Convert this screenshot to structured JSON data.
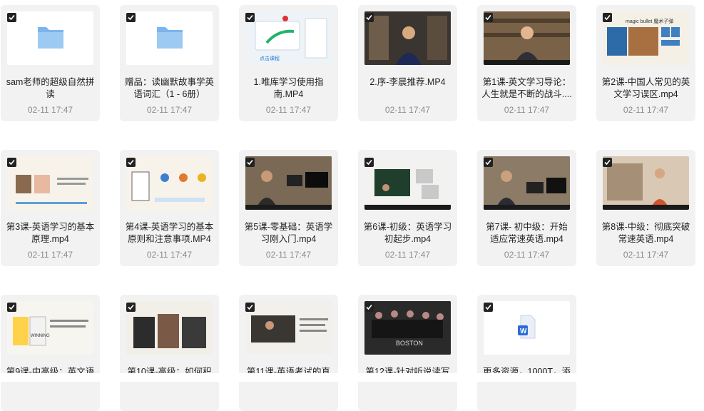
{
  "files": [
    {
      "title": "sam老师的超级自然拼读",
      "date": "02-11 17:47",
      "type": "folder",
      "icon": "folder-icon"
    },
    {
      "title": "赠品：读幽默故事学英语词汇（1 - 6册）",
      "date": "02-11 17:47",
      "type": "folder",
      "icon": "folder-icon"
    },
    {
      "title": "1.唯库学习使用指南.MP4",
      "date": "02-11 17:47",
      "type": "video"
    },
    {
      "title": "2.序-李晨推荐.MP4",
      "date": "02-11 17:47",
      "type": "video"
    },
    {
      "title": "第1课-英文学习导论：人生就是不断的战斗....",
      "date": "02-11 17:47",
      "type": "video"
    },
    {
      "title": "第2课-中国人常见的英文学习误区.mp4",
      "date": "02-11 17:47",
      "type": "video",
      "thumb_text": "magic bullet 魔术子弹"
    },
    {
      "title": "第3课-英语学习的基本原理.mp4",
      "date": "02-11 17:47",
      "type": "video"
    },
    {
      "title": "第4课-英语学习的基本原则和注意事项.MP4",
      "date": "02-11 17:47",
      "type": "video"
    },
    {
      "title": "第5课-零基础：英语学习刚入门.mp4",
      "date": "02-11 17:47",
      "type": "video"
    },
    {
      "title": "第6课-初级：英语学习初起步.mp4",
      "date": "02-11 17:47",
      "type": "video"
    },
    {
      "title": "第7课- 初中级：开始适应常速英语.mp4",
      "date": "02-11 17:47",
      "type": "video"
    },
    {
      "title": "第8课-中级：彻底突破常速英语.mp4",
      "date": "02-11 17:47",
      "type": "video"
    },
    {
      "title": "第9课-中高级：英文语",
      "date": "",
      "type": "video",
      "thumb_text": "WINNING"
    },
    {
      "title": "第10课-高级：如何积",
      "date": "",
      "type": "video"
    },
    {
      "title": "第11课-英语考试的真",
      "date": "",
      "type": "video"
    },
    {
      "title": "第12课-针对听说读写",
      "date": "",
      "type": "video",
      "thumb_text": "BOSTON"
    },
    {
      "title": "更多资源，1000T，添",
      "date": "",
      "type": "document",
      "icon": "word-icon",
      "thumb_text": "W"
    }
  ],
  "colors": {
    "folder": "#7cb5ec",
    "word": "#2b6cd8",
    "card": "#f2f2f2",
    "date": "#8a8a8a"
  }
}
